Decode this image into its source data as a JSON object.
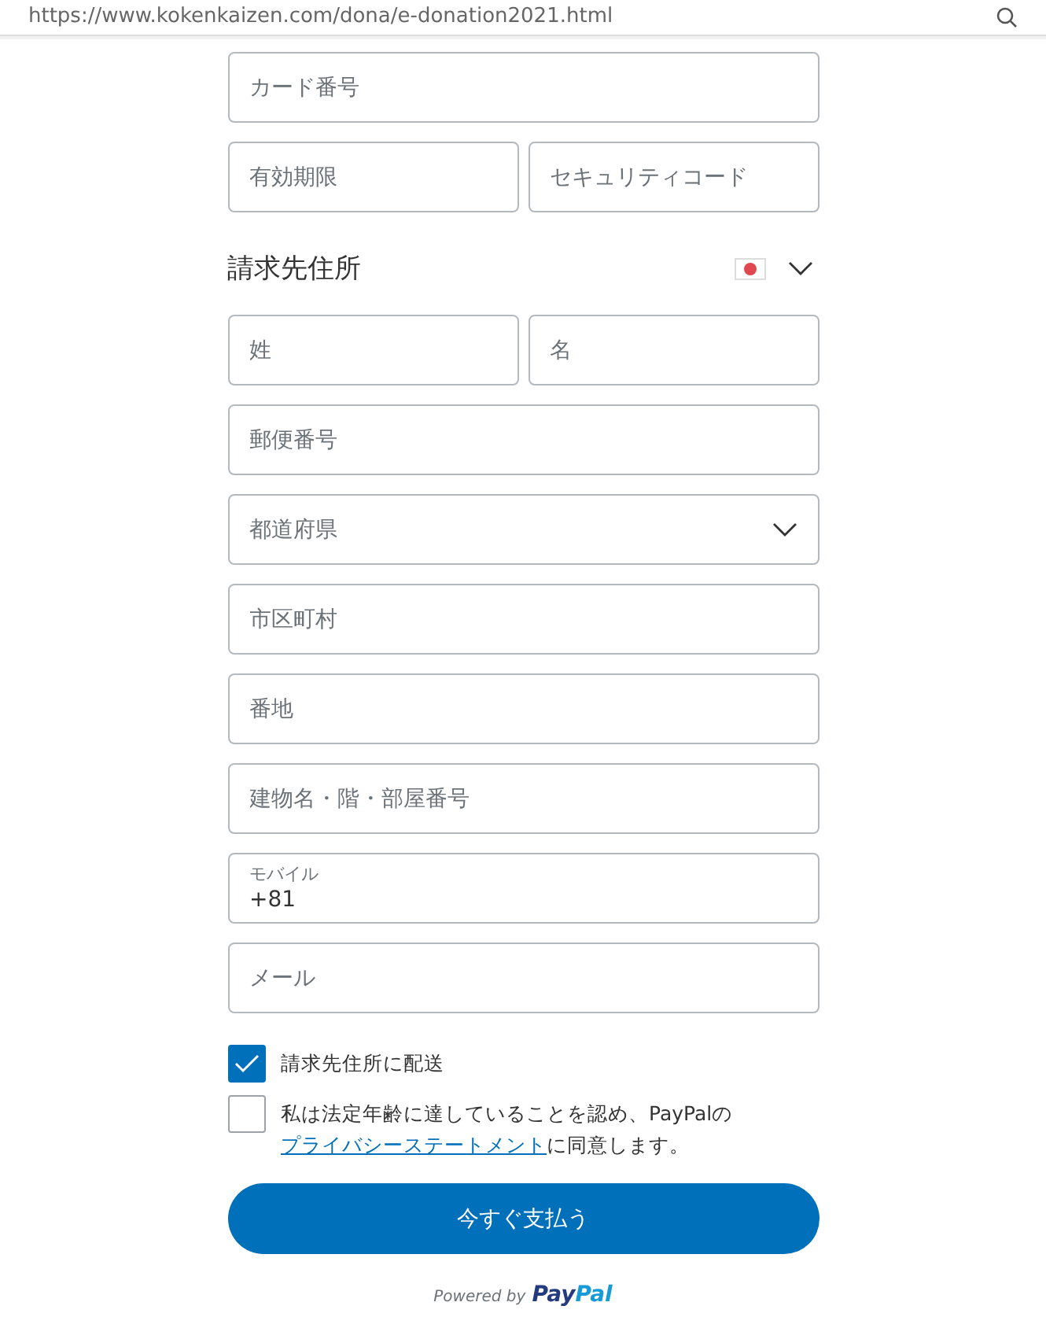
{
  "address_bar": {
    "url": "https://www.kokenkaizen.com/dona/e-donation2021.html"
  },
  "card_fields": [
    {
      "kind": "text",
      "placeholder": "カード番号"
    },
    {
      "kind": "pair",
      "items": [
        {
          "placeholder": "有効期限"
        },
        {
          "placeholder": "セキュリティコード"
        }
      ]
    }
  ],
  "billing": {
    "heading": "請求先住所",
    "fields": [
      {
        "kind": "pair",
        "items": [
          {
            "placeholder": "姓"
          },
          {
            "placeholder": "名"
          }
        ]
      },
      {
        "kind": "text",
        "placeholder": "郵便番号"
      },
      {
        "kind": "select",
        "placeholder": "都道府県"
      },
      {
        "kind": "text",
        "placeholder": "市区町村"
      },
      {
        "kind": "text",
        "placeholder": "番地"
      },
      {
        "kind": "text",
        "placeholder": "建物名・階・部屋番号"
      },
      {
        "kind": "labeled",
        "label": "モバイル",
        "value": "+81"
      },
      {
        "kind": "text",
        "placeholder": "メール"
      }
    ]
  },
  "checkboxes": [
    {
      "checked": true,
      "text": "請求先住所に配送"
    },
    {
      "checked": false,
      "text": "私は法定年齢に達していることを認め、PayPalの",
      "link": "プライバシーステートメント",
      "text_after": "に同意します。"
    }
  ],
  "pay_button": "今すぐ支払う",
  "footer": {
    "powered": "Powered by",
    "brand_first": "Pay",
    "brand_second": "Pal"
  }
}
